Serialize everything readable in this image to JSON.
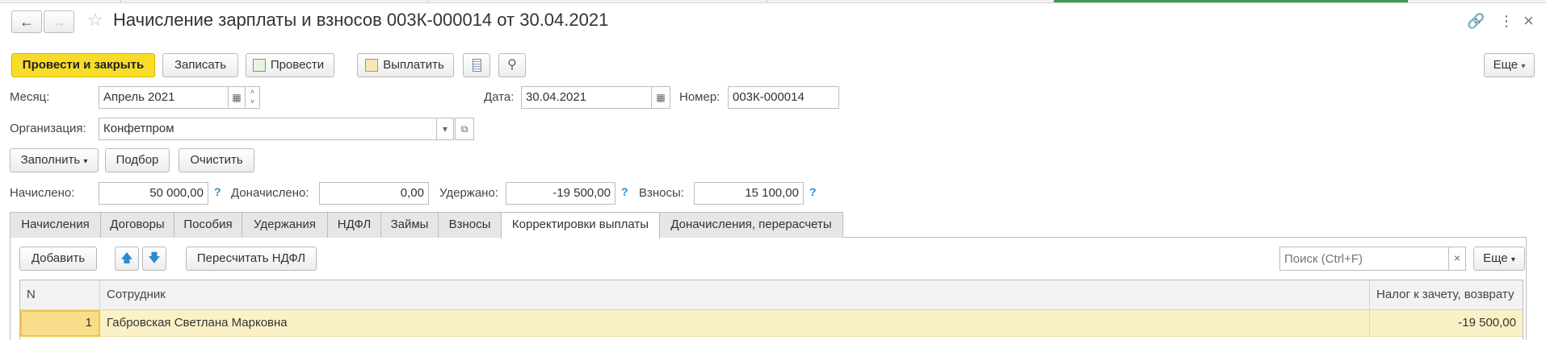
{
  "window": {
    "title": "Начисление зарплаты и взносов 003К-000014 от 30.04.2021",
    "nav_back": "←",
    "nav_forward": "→",
    "star_glyph": "☆",
    "link_glyph": "🔗",
    "menu_glyph": "⋮",
    "close_glyph": "×"
  },
  "toolbar": {
    "post_and_close": "Провести и закрыть",
    "save": "Записать",
    "post": "Провести",
    "pay": "Выплатить",
    "more": "Еще"
  },
  "form": {
    "month_label": "Месяц:",
    "month_value": "Апрель 2021",
    "date_label": "Дата:",
    "date_value": "30.04.2021",
    "number_label": "Номер:",
    "number_value": "003К-000014",
    "org_label": "Организация:",
    "org_value": "Конфетпром"
  },
  "actions": {
    "fill": "Заполнить",
    "pick": "Подбор",
    "clear": "Очистить"
  },
  "totals": {
    "accrued_label": "Начислено:",
    "accrued_value": "50 000,00",
    "extra_label": "Доначислено:",
    "extra_value": "0,00",
    "withheld_label": "Удержано:",
    "withheld_value": "-19 500,00",
    "contrib_label": "Взносы:",
    "contrib_value": "15 100,00",
    "help_glyph": "?"
  },
  "tabs": [
    {
      "label": "Начисления"
    },
    {
      "label": "Договоры"
    },
    {
      "label": "Пособия"
    },
    {
      "label": "Удержания"
    },
    {
      "label": "НДФЛ"
    },
    {
      "label": "Займы"
    },
    {
      "label": "Взносы"
    },
    {
      "label": "Корректировки выплаты",
      "active": true
    },
    {
      "label": "Доначисления, перерасчеты"
    }
  ],
  "panel": {
    "add": "Добавить",
    "recalc": "Пересчитать НДФЛ",
    "search_placeholder": "Поиск (Ctrl+F)",
    "search_clear": "×",
    "more": "Еще"
  },
  "table": {
    "columns": [
      "N",
      "Сотрудник",
      "Налог к зачету, возврату"
    ],
    "rows": [
      {
        "n": "1",
        "employee": "Габровская Светлана Марковна",
        "tax": "-19 500,00"
      }
    ]
  }
}
